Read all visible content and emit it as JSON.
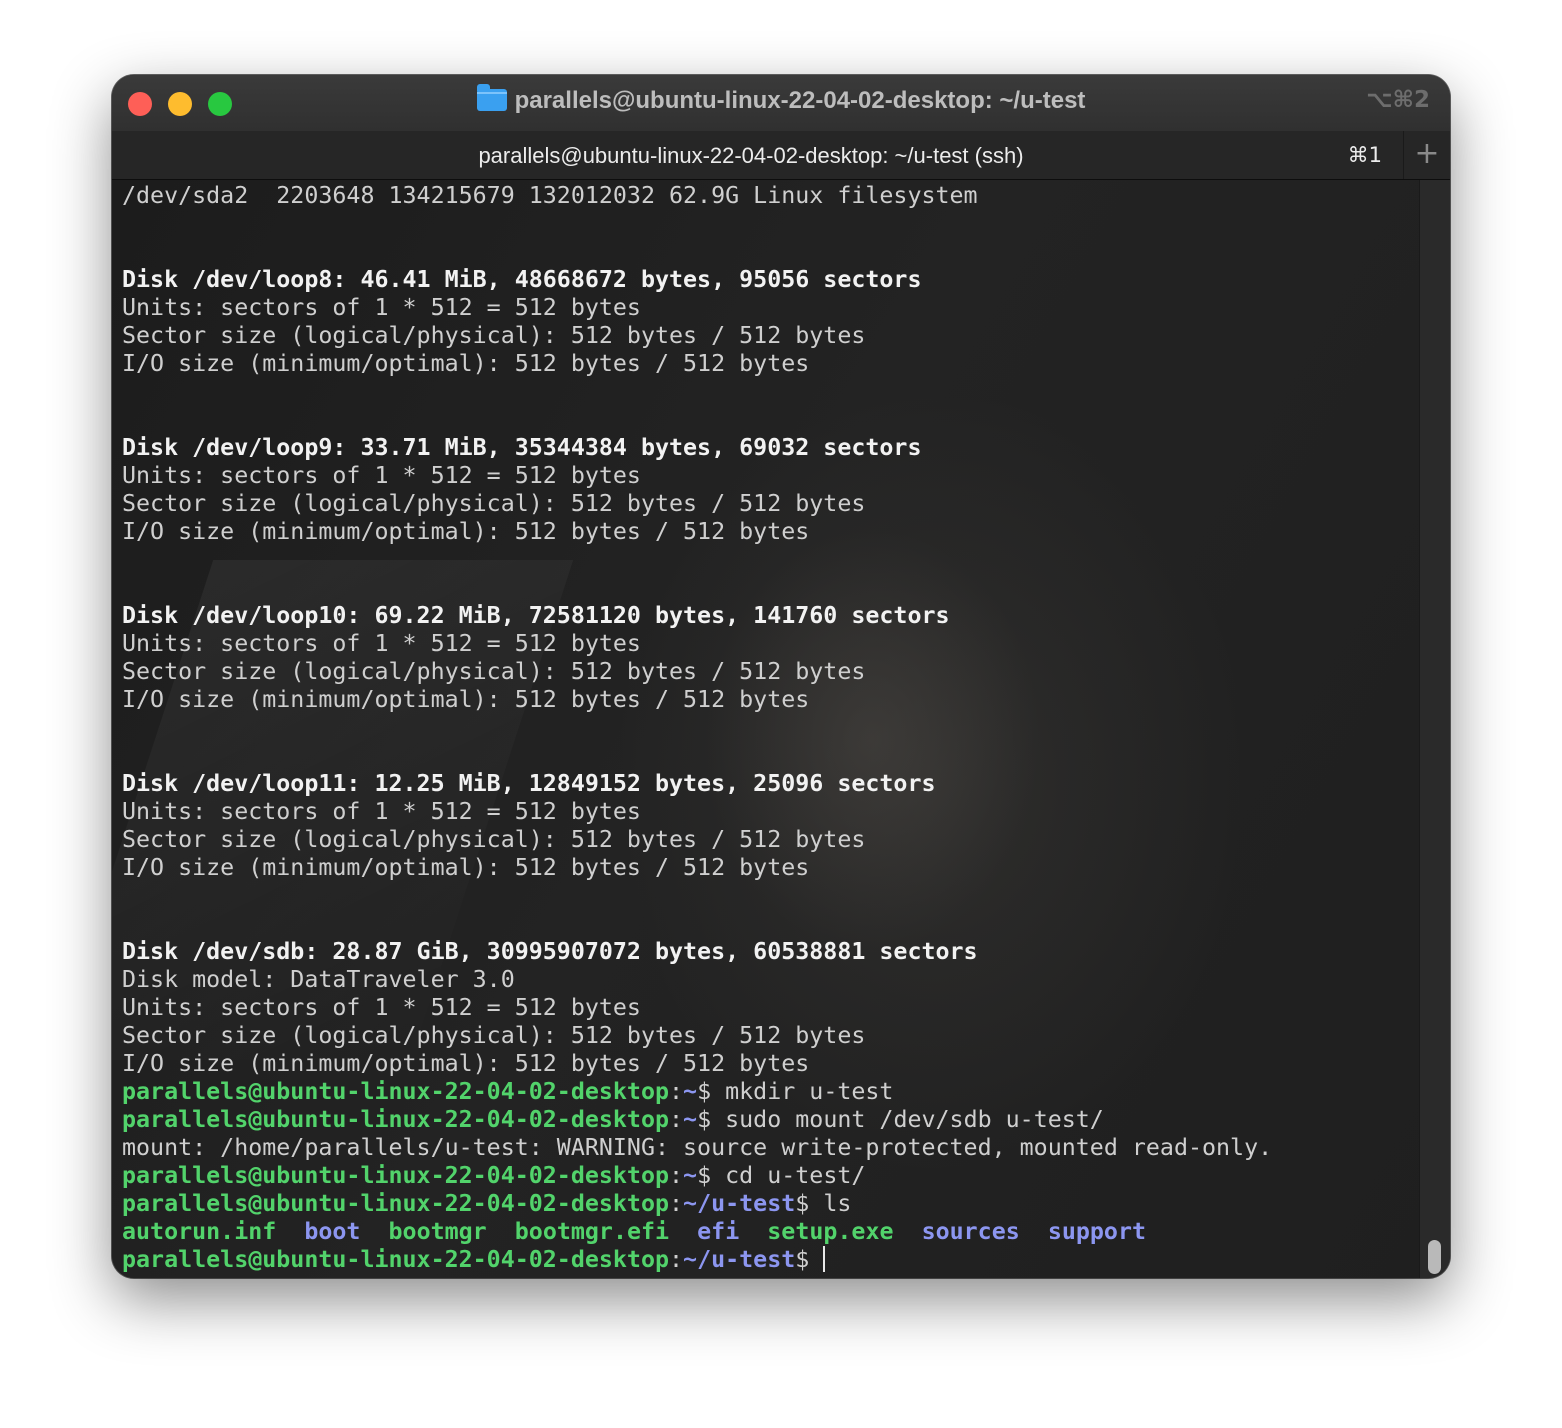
{
  "window": {
    "title": "parallels@ubuntu-linux-22-04-02-desktop: ~/u-test",
    "window_shortcut": "⌥⌘2",
    "folder_icon": "folder-icon"
  },
  "tab": {
    "title": "parallels@ubuntu-linux-22-04-02-desktop: ~/u-test (ssh)",
    "shortcut": "⌘1",
    "new_tab_label": "+"
  },
  "terminal": {
    "prompt_user": "parallels@ubuntu-linux-22-04-02-desktop",
    "lines": [
      "/dev/sda2  2203648 134215679 132012032 62.9G Linux filesystem",
      "",
      "",
      "Disk /dev/loop8: 46.41 MiB, 48668672 bytes, 95056 sectors",
      "Units: sectors of 1 * 512 = 512 bytes",
      "Sector size (logical/physical): 512 bytes / 512 bytes",
      "I/O size (minimum/optimal): 512 bytes / 512 bytes",
      "",
      "",
      "Disk /dev/loop9: 33.71 MiB, 35344384 bytes, 69032 sectors",
      "Units: sectors of 1 * 512 = 512 bytes",
      "Sector size (logical/physical): 512 bytes / 512 bytes",
      "I/O size (minimum/optimal): 512 bytes / 512 bytes",
      "",
      "",
      "Disk /dev/loop10: 69.22 MiB, 72581120 bytes, 141760 sectors",
      "Units: sectors of 1 * 512 = 512 bytes",
      "Sector size (logical/physical): 512 bytes / 512 bytes",
      "I/O size (minimum/optimal): 512 bytes / 512 bytes",
      "",
      "",
      "Disk /dev/loop11: 12.25 MiB, 12849152 bytes, 25096 sectors",
      "Units: sectors of 1 * 512 = 512 bytes",
      "Sector size (logical/physical): 512 bytes / 512 bytes",
      "I/O size (minimum/optimal): 512 bytes / 512 bytes",
      "",
      "",
      "Disk /dev/sdb: 28.87 GiB, 30995907072 bytes, 60538881 sectors",
      "Disk model: DataTraveler 3.0",
      "Units: sectors of 1 * 512 = 512 bytes",
      "Sector size (logical/physical): 512 bytes / 512 bytes",
      "I/O size (minimum/optimal): 512 bytes / 512 bytes"
    ],
    "commands": [
      {
        "path": "~",
        "cmd": " mkdir u-test"
      },
      {
        "path": "~",
        "cmd": " sudo mount /dev/sdb u-test/"
      },
      {
        "output": "mount: /home/parallels/u-test: WARNING: source write-protected, mounted read-only."
      },
      {
        "path": "~",
        "cmd": " cd u-test/"
      },
      {
        "path": "~/u-test",
        "cmd": " ls"
      }
    ],
    "ls_entries": [
      {
        "name": "autorun.inf",
        "type": "exe"
      },
      {
        "name": "boot",
        "type": "dir"
      },
      {
        "name": "bootmgr",
        "type": "exe"
      },
      {
        "name": "bootmgr.efi",
        "type": "exe"
      },
      {
        "name": "efi",
        "type": "dir"
      },
      {
        "name": "setup.exe",
        "type": "exe"
      },
      {
        "name": "sources",
        "type": "dir"
      },
      {
        "name": "support",
        "type": "dir"
      }
    ],
    "final_prompt_path": "~/u-test",
    "colors": {
      "user": "#52d36b",
      "path": "#8c96f0",
      "text": "#cfcfcf"
    }
  }
}
